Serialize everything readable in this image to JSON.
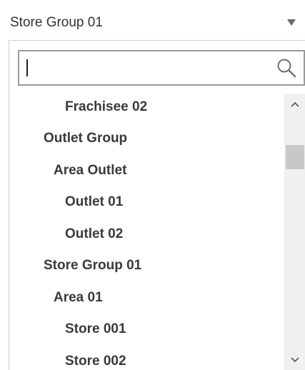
{
  "combo": {
    "selected_value": "Store Group 01",
    "icon": "chevron-down-icon"
  },
  "search": {
    "value": "",
    "icon": "search-icon"
  },
  "tree_items": [
    {
      "label": "Frachisee 02",
      "level": 3
    },
    {
      "label": "Outlet Group",
      "level": 1
    },
    {
      "label": "Area Outlet",
      "level": 2
    },
    {
      "label": "Outlet 01",
      "level": 3
    },
    {
      "label": "Outlet 02",
      "level": 3
    },
    {
      "label": "Store Group 01",
      "level": 1
    },
    {
      "label": "Area 01",
      "level": 2
    },
    {
      "label": "Store 001",
      "level": 3
    },
    {
      "label": "Store 002",
      "level": 3
    }
  ],
  "scrollbar": {
    "up_icon": "scroll-up-icon",
    "down_icon": "scroll-down-icon"
  }
}
